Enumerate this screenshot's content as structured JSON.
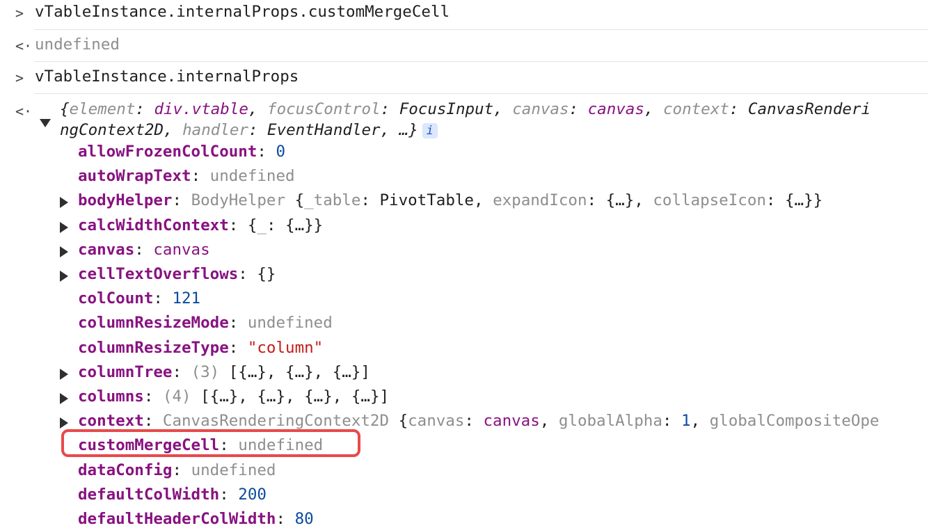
{
  "console": {
    "entries": [
      {
        "kind": "input",
        "prompt_glyph": ">",
        "text": "vTableInstance.internalProps.customMergeCell"
      },
      {
        "kind": "output",
        "prompt_glyph": "<·",
        "text": "undefined"
      },
      {
        "kind": "input",
        "prompt_glyph": ">",
        "text": "vTableInstance.internalProps"
      }
    ],
    "object_summary": {
      "prompt_glyph": "<·",
      "line1": [
        {
          "t": "{",
          "c": "t"
        },
        {
          "t": "element",
          "c": "ik"
        },
        {
          "t": ": ",
          "c": "t"
        },
        {
          "t": "div.vtable",
          "c": "m"
        },
        {
          "t": ", ",
          "c": "t"
        },
        {
          "t": "focusControl",
          "c": "ik"
        },
        {
          "t": ": ",
          "c": "t"
        },
        {
          "t": "FocusInput",
          "c": "t"
        },
        {
          "t": ", ",
          "c": "t"
        },
        {
          "t": "canvas",
          "c": "ik"
        },
        {
          "t": ": ",
          "c": "t"
        },
        {
          "t": "canvas",
          "c": "m"
        },
        {
          "t": ", ",
          "c": "t"
        },
        {
          "t": "context",
          "c": "ik"
        },
        {
          "t": ": ",
          "c": "t"
        },
        {
          "t": "CanvasRenderi",
          "c": "t"
        }
      ],
      "line2": [
        {
          "t": "ngContext2D",
          "c": "t"
        },
        {
          "t": ", ",
          "c": "t"
        },
        {
          "t": "handler",
          "c": "ik"
        },
        {
          "t": ": ",
          "c": "t"
        },
        {
          "t": "EventHandler",
          "c": "t"
        },
        {
          "t": ", …}",
          "c": "t"
        }
      ],
      "info_badge": "i"
    },
    "properties": [
      {
        "key": "allowFrozenColCount",
        "expandable": false,
        "value": [
          {
            "t": "0",
            "c": "n"
          }
        ]
      },
      {
        "key": "autoWrapText",
        "expandable": false,
        "value": [
          {
            "t": "undefined",
            "c": "g"
          }
        ]
      },
      {
        "key": "bodyHelper",
        "expandable": true,
        "value": [
          {
            "t": "BodyHelper ",
            "c": "g"
          },
          {
            "t": "{",
            "c": "c"
          },
          {
            "t": "_table",
            "c": "g"
          },
          {
            "t": ": ",
            "c": "c"
          },
          {
            "t": "PivotTable",
            "c": "c"
          },
          {
            "t": ", ",
            "c": "c"
          },
          {
            "t": "expandIcon",
            "c": "g"
          },
          {
            "t": ": {…}, ",
            "c": "c"
          },
          {
            "t": "collapseIcon",
            "c": "g"
          },
          {
            "t": ": {…}}",
            "c": "c"
          }
        ]
      },
      {
        "key": "calcWidthContext",
        "expandable": true,
        "value": [
          {
            "t": "{",
            "c": "c"
          },
          {
            "t": "_",
            "c": "g"
          },
          {
            "t": ": {…}}",
            "c": "c"
          }
        ]
      },
      {
        "key": "canvas",
        "expandable": true,
        "value": [
          {
            "t": "canvas",
            "c": "m"
          }
        ]
      },
      {
        "key": "cellTextOverflows",
        "expandable": true,
        "value": [
          {
            "t": "{}",
            "c": "c"
          }
        ]
      },
      {
        "key": "colCount",
        "expandable": false,
        "value": [
          {
            "t": "121",
            "c": "n"
          }
        ]
      },
      {
        "key": "columnResizeMode",
        "expandable": false,
        "value": [
          {
            "t": "undefined",
            "c": "g"
          }
        ]
      },
      {
        "key": "columnResizeType",
        "expandable": false,
        "value": [
          {
            "t": "\"column\"",
            "c": "s"
          }
        ]
      },
      {
        "key": "columnTree",
        "expandable": true,
        "value": [
          {
            "t": "(3) ",
            "c": "g"
          },
          {
            "t": "[{…}, {…}, {…}]",
            "c": "c"
          }
        ]
      },
      {
        "key": "columns",
        "expandable": true,
        "value": [
          {
            "t": "(4) ",
            "c": "g"
          },
          {
            "t": "[{…}, {…}, {…}, {…}]",
            "c": "c"
          }
        ]
      },
      {
        "key": "context",
        "expandable": true,
        "value": [
          {
            "t": "CanvasRenderingContext2D ",
            "c": "g"
          },
          {
            "t": "{",
            "c": "c"
          },
          {
            "t": "canvas",
            "c": "g"
          },
          {
            "t": ": ",
            "c": "c"
          },
          {
            "t": "canvas",
            "c": "m"
          },
          {
            "t": ", ",
            "c": "c"
          },
          {
            "t": "globalAlpha",
            "c": "g"
          },
          {
            "t": ": ",
            "c": "c"
          },
          {
            "t": "1",
            "c": "n"
          },
          {
            "t": ", ",
            "c": "c"
          },
          {
            "t": "globalCompositeOpe",
            "c": "g"
          }
        ]
      },
      {
        "key": "customMergeCell",
        "expandable": false,
        "highlighted": true,
        "value": [
          {
            "t": "undefined",
            "c": "g"
          }
        ]
      },
      {
        "key": "dataConfig",
        "expandable": false,
        "value": [
          {
            "t": "undefined",
            "c": "g"
          }
        ]
      },
      {
        "key": "defaultColWidth",
        "expandable": false,
        "value": [
          {
            "t": "200",
            "c": "n"
          }
        ]
      },
      {
        "key": "defaultHeaderColWidth",
        "expandable": false,
        "value": [
          {
            "t": "80",
            "c": "n"
          }
        ]
      }
    ],
    "colors": {
      "highlight_border": "#e8494b",
      "property_key": "#881280",
      "number": "#0b4a9e",
      "string": "#c41a16"
    }
  }
}
